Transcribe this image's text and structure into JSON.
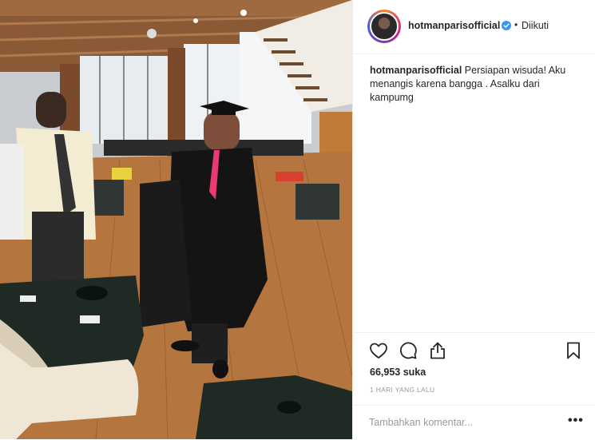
{
  "post": {
    "username": "hotmanparisofficial",
    "separator": "•",
    "follow_state": "Diikuti",
    "caption_username": "hotmanparisofficial",
    "caption_text": "Persiapan wisuda! Aku menangis karena bangga . Asalku dari kampumg",
    "likes_count": "66,953",
    "likes_word": "suka",
    "timestamp": "1 HARI YANG LALU",
    "comment_placeholder": "Tambahkan komentar...",
    "more_options": "•••"
  },
  "icons": {
    "verified": "verified-badge-icon",
    "like": "heart-icon",
    "comment": "comment-bubble-icon",
    "share": "share-icon",
    "save": "bookmark-icon",
    "more": "more-options-icon"
  },
  "colors": {
    "verified_blue": "#3897f0",
    "text": "#262626",
    "muted": "#999999",
    "border": "#efefef"
  }
}
